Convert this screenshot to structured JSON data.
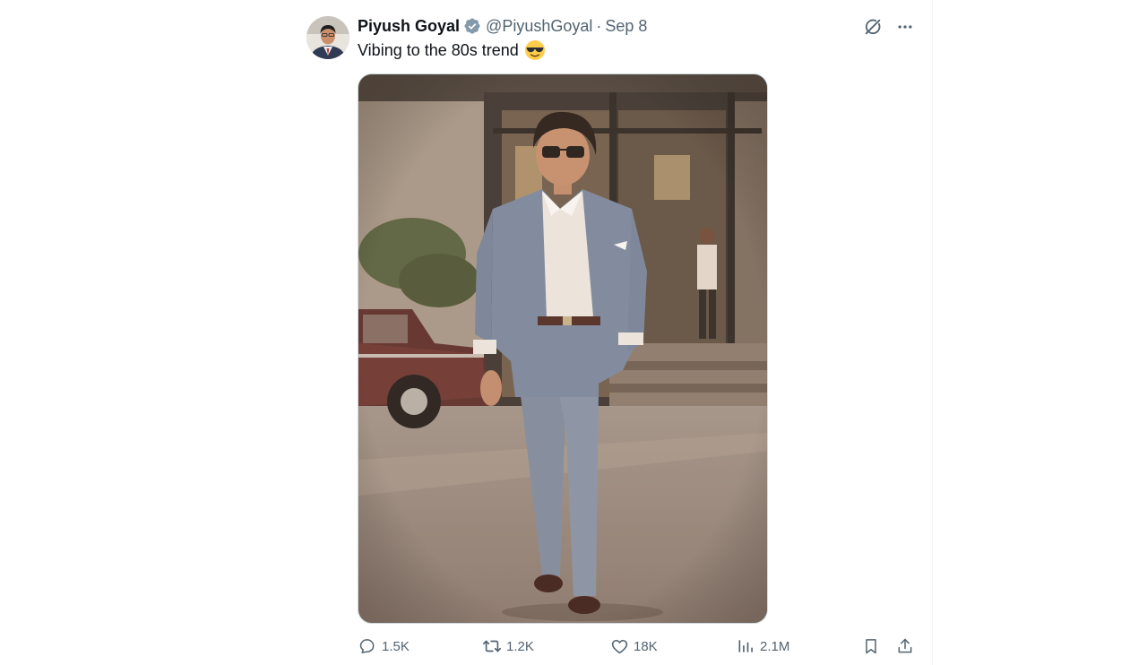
{
  "post": {
    "author": {
      "display_name": "Piyush Goyal",
      "handle": "@PiyushGoyal",
      "verified_icon": "verified-badge-icon",
      "avatar_icon": "avatar-photo"
    },
    "separator": "·",
    "date": "Sep 8",
    "text": "Vibing to the 80s trend",
    "emoji": "smiling-face-with-sunglasses",
    "media_icon": "photo-man-in-blue-suit-walking"
  },
  "top_actions": {
    "grok_icon": "grok-icon",
    "more_icon": "more-dots-icon"
  },
  "engagement": {
    "replies": "1.5K",
    "reposts": "1.2K",
    "likes": "18K",
    "views": "2.1M"
  },
  "colors": {
    "text_primary": "#0f1419",
    "text_secondary": "#536471",
    "verified_blue": "#829aab",
    "border": "#cfd9de"
  }
}
